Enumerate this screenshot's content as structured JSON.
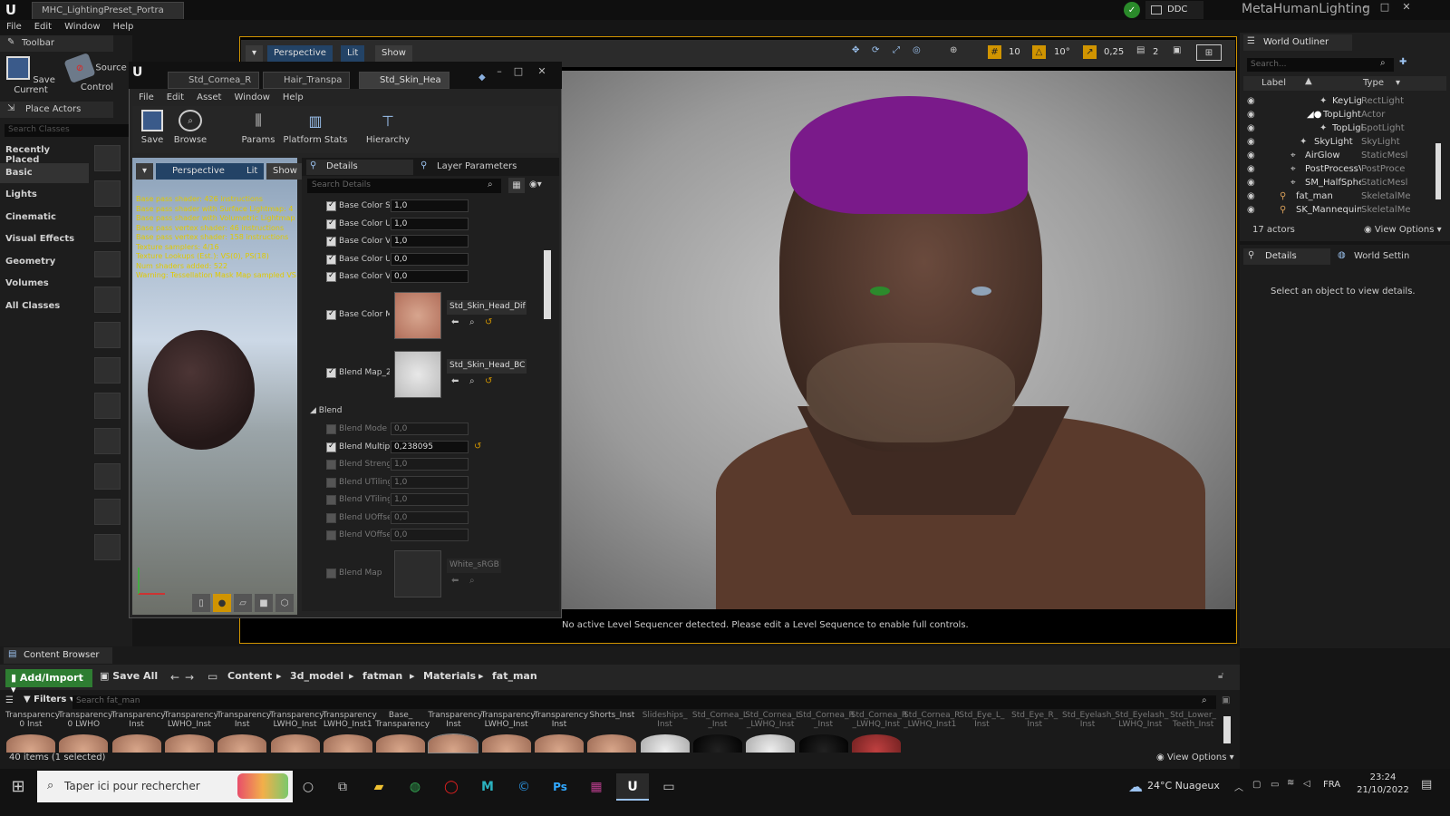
{
  "app": {
    "doc_tab": "MHC_LightingPreset_Portra",
    "ddc": "DDC",
    "project": "MetaHumanLighting",
    "menus": [
      "File",
      "Edit",
      "Window",
      "Help"
    ]
  },
  "toolbar": {
    "title": "Toolbar",
    "save_current": "Save Current",
    "source_control": "Source Control"
  },
  "place_actors": {
    "title": "Place Actors",
    "search_placeholder": "Search Classes",
    "categories": [
      "Recently Placed",
      "Basic",
      "Lights",
      "Cinematic",
      "Visual Effects",
      "Geometry",
      "Volumes",
      "All Classes"
    ],
    "selected": "Basic"
  },
  "viewport": {
    "perspective": "Perspective",
    "lit": "Lit",
    "show": "Show",
    "grid_snap": "10",
    "rot_snap": "10°",
    "scale_snap": "0,25",
    "cam_speed": "2",
    "sequencer_msg": "No active Level Sequencer detected. Please edit a Level Sequence to enable full controls."
  },
  "material_editor": {
    "tabs": [
      "Std_Cornea_R",
      "Hair_Transpa",
      "Std_Skin_Hea"
    ],
    "menus": [
      "File",
      "Edit",
      "Asset",
      "Window",
      "Help"
    ],
    "tools": {
      "save": "Save",
      "browse": "Browse",
      "params": "Params",
      "platform_stats": "Platform Stats",
      "hierarchy": "Hierarchy"
    },
    "preview": {
      "perspective": "Perspective",
      "lit": "Lit",
      "show": "Show"
    },
    "stats": [
      "Base pass shader: 426 instructions",
      "Base pass shader with Surface Lightmap: 4",
      "Base pass shader with Volumetric Lightmap",
      "Base pass vertex shader: 46 instructions",
      "Base pass vertex shader: 158 instructions",
      "Texture samplers: 4/16",
      "Texture Lookups (Est.): VS(0), PS(18)",
      "Num shaders added: 522",
      "Warning: Tessellation Mask Map sampled VS"
    ],
    "details_tab": "Details",
    "layer_tab": "Layer Parameters",
    "search_placeholder": "Search Details",
    "params": [
      {
        "label": "Base Color St",
        "value": "1,0"
      },
      {
        "label": "Base Color U",
        "value": "1,0"
      },
      {
        "label": "Base Color V",
        "value": "1,0"
      },
      {
        "label": "Base Color U",
        "value": "0,0"
      },
      {
        "label": "Base Color V",
        "value": "0,0"
      }
    ],
    "base_color_map": {
      "label": "Base Color M",
      "texture": "Std_Skin_Head_Dif"
    },
    "blend_map2": {
      "label": "Blend Map_2",
      "texture": "Std_Skin_Head_BC"
    },
    "blend_group": "Blend",
    "blend_params": [
      {
        "label": "Blend Mode",
        "value": "0,0",
        "on": false
      },
      {
        "label": "Blend Multipl",
        "value": "0,238095",
        "on": true
      },
      {
        "label": "Blend Strengt",
        "value": "1,0",
        "on": false
      },
      {
        "label": "Blend UTiling",
        "value": "1,0",
        "on": false
      },
      {
        "label": "Blend VTiling",
        "value": "1,0",
        "on": false
      },
      {
        "label": "Blend UOffse",
        "value": "0,0",
        "on": false
      },
      {
        "label": "Blend VOffse",
        "value": "0,0",
        "on": false
      }
    ],
    "blend_map": {
      "label": "Blend Map",
      "texture": "White_sRGB"
    }
  },
  "outliner": {
    "title": "World Outliner",
    "search_placeholder": "Search...",
    "col_label": "Label",
    "col_type": "Type",
    "rows": [
      {
        "label": "KeyLigl",
        "type": "RectLight"
      },
      {
        "label": "TopLight",
        "type": "Actor"
      },
      {
        "label": "TopLigl",
        "type": "SpotLight"
      },
      {
        "label": "SkyLight",
        "type": "SkyLight"
      },
      {
        "label": "AirGlow",
        "type": "StaticMesl"
      },
      {
        "label": "PostProcessV",
        "type": "PostProce"
      },
      {
        "label": "SM_HalfSpher",
        "type": "StaticMesl"
      },
      {
        "label": "fat_man",
        "type": "SkeletalMe"
      },
      {
        "label": "SK_Mannequin",
        "type": "SkeletalMe"
      }
    ],
    "count": "17 actors",
    "view_options": "View Options"
  },
  "details_panel": {
    "tab": "Details",
    "world_settings": "World Settin",
    "empty_msg": "Select an object to view details."
  },
  "content_browser": {
    "title": "Content Browser",
    "add_import": "Add/Import",
    "save_all": "Save All",
    "path": [
      "Content",
      "3d_model",
      "fatman",
      "Materials",
      "fat_man"
    ],
    "filters": "Filters",
    "search_placeholder": "Search fat_man",
    "assets": [
      "Transparency 0 Inst",
      "Transparency 0 LWHO",
      "Transparency Inst",
      "Transparency LWHO_Inst",
      "Transparency Inst",
      "Transparency LWHO_Inst",
      "Transparency LWHO_Inst1",
      "Base_ Transparency",
      "Transparency Inst",
      "Transparency LWHO_Inst",
      "Transparency Inst",
      "Shorts_Inst",
      "Slideships_ Inst",
      "Std_Cornea_L _Inst",
      "Std_Cornea_L _LWHQ_Inst",
      "Std_Cornea_R _Inst",
      "Std_Cornea_R _LWHQ_Inst",
      "Std_Cornea_R _LWHQ_Inst1",
      "Std_Eye_L_ Inst",
      "Std_Eye_R_ Inst",
      "Std_Eyelash_ Inst",
      "Std_Eyelash_ LWHQ_Inst",
      "Std_Lower_ Teeth_Inst"
    ],
    "status": "40 items (1 selected)",
    "view_options": "View Options"
  },
  "taskbar": {
    "search": "Taper ici pour rechercher",
    "weather": "24°C Nuageux",
    "lang": "FRA",
    "time": "23:24",
    "date": "21/10/2022"
  },
  "colors": {
    "accent": "#d09400",
    "selected": "#234366",
    "hair": "#7a1a8a"
  }
}
